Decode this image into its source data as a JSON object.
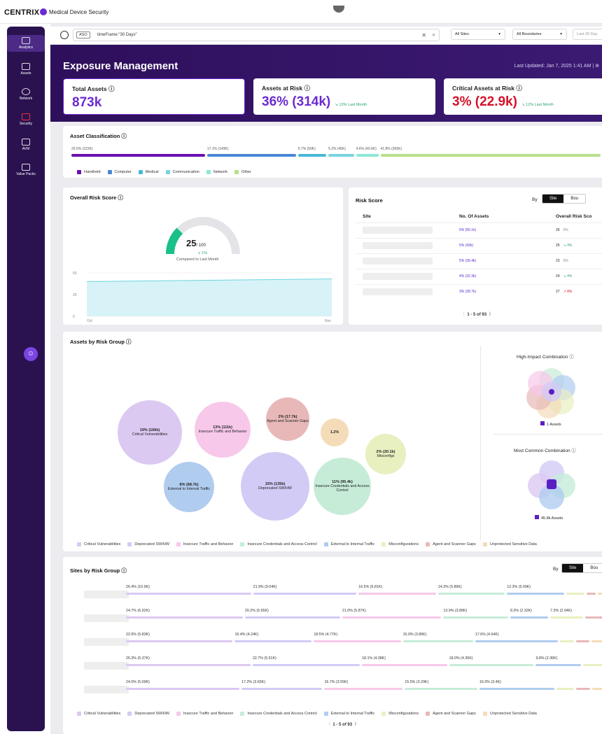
{
  "app": {
    "logo": "CENTRIX",
    "title": "Medical Device Security"
  },
  "sidebar": {
    "items": [
      {
        "label": "Analytics",
        "icon": "analytics-icon"
      },
      {
        "label": "Assets",
        "icon": "assets-icon"
      },
      {
        "label": "Network",
        "icon": "network-icon"
      },
      {
        "label": "Security",
        "icon": "security-icon"
      },
      {
        "label": "AVM",
        "icon": "avm-icon"
      },
      {
        "label": "Value Packs",
        "icon": "value-packs-icon"
      }
    ]
  },
  "filter": {
    "aso": "ASO",
    "query": "timeFrame:\"30 Days\"",
    "clear": "✕",
    "search": "⌕",
    "sites": "All Sites",
    "boundaries": "All Boundaries",
    "timeframe": "Last 30 Day"
  },
  "header": {
    "title": "Exposure Management",
    "updated": "Last Updated: Jan 7, 2025 1:41 AM | ⊕"
  },
  "kpis": [
    {
      "label": "Total Assets ⓘ",
      "value": "873k",
      "delta": ""
    },
    {
      "label": "Assets at Risk ⓘ",
      "value": "36% (314k)",
      "delta": "↘ 13% Last Month"
    },
    {
      "label": "Critical Assets at Risk ⓘ",
      "value": "3% (22.9k)",
      "delta": "↘ 12% Last Month"
    }
  ],
  "classification": {
    "title": "Asset Classification ⓘ",
    "segments": [
      {
        "label": "25.5% (223K)",
        "pct": 25.5,
        "color": "#6a0fb0"
      },
      {
        "label": "17.1% (149K)",
        "pct": 17.1,
        "color": "#4a86d6"
      },
      {
        "label": "5.7% (50K)",
        "pct": 5.7,
        "color": "#49b8d8"
      },
      {
        "label": "5.2% (45K)",
        "pct": 5.2,
        "color": "#7ad3e0"
      },
      {
        "label": "4.6% (40.6K)",
        "pct": 4.6,
        "color": "#8de8d6"
      },
      {
        "label": "41.8% (365K)",
        "pct": 41.8,
        "color": "#b8e08a"
      }
    ],
    "legend": [
      {
        "label": "Handheld",
        "color": "#6a0fb0"
      },
      {
        "label": "Computer",
        "color": "#4a86d6"
      },
      {
        "label": "Medical",
        "color": "#49b8d8"
      },
      {
        "label": "Communication",
        "color": "#7ad3e0"
      },
      {
        "label": "Network",
        "color": "#8de8d6"
      },
      {
        "label": "Other",
        "color": "#b8e08a"
      }
    ]
  },
  "overall_risk": {
    "title": "Overall Risk Score ⓘ",
    "score": "25",
    "of": "/ 100",
    "delta": "↘ 1%",
    "note": "Compared to Last Month",
    "score_value": 25
  },
  "chart_data": {
    "type": "area",
    "x": [
      "Oct",
      "Nov"
    ],
    "values": [
      40,
      43
    ],
    "xlabel": "",
    "ylabel": "",
    "yticks": [
      "50",
      "25",
      "0"
    ],
    "ylim": [
      0,
      50
    ]
  },
  "risk_score": {
    "title": "Risk Score",
    "by": "By",
    "site": "Site",
    "boundary": "Bou",
    "columns": [
      "Site",
      "No. Of Assets",
      "Overall Risk Sco"
    ],
    "rows": [
      {
        "assets": "6% (55.1k)",
        "score": "26",
        "delta": "0%",
        "dcolor": "#888"
      },
      {
        "assets": "5% (43k)",
        "score": "25",
        "delta": "↘ 4%",
        "dcolor": "#2aa36b"
      },
      {
        "assets": "5% (39.4k)",
        "score": "23",
        "delta": "0%",
        "dcolor": "#888"
      },
      {
        "assets": "4% (32.3k)",
        "score": "24",
        "delta": "↘ 4%",
        "dcolor": "#2aa36b"
      },
      {
        "assets": "3% (28.7k)",
        "score": "27",
        "delta": "↗ 8%",
        "dcolor": "#d4122a"
      }
    ],
    "pager": "1 - 5 of 93"
  },
  "risk_group": {
    "title": "Assets by Risk Group ⓘ",
    "bubbles": [
      {
        "pct": "19% (166k)",
        "label": "Critical Vulnerabilities",
        "color": "#dcc9f2"
      },
      {
        "pct": "13% (111k)",
        "label": "Insecure Traffic and Behavior",
        "color": "#f7c8ea"
      },
      {
        "pct": "2% (17.7k)",
        "label": "Agent and Scanner Gaps",
        "color": "#e8b8b8"
      },
      {
        "pct": "1.2%",
        "label": "",
        "color": "#f4dcb8"
      },
      {
        "pct": "2% (20.1k)",
        "label": "Misconfigs",
        "color": "#e8f0c0"
      },
      {
        "pct": "8% (68.7k)",
        "label": "External to Internal Traffic",
        "color": "#b0ccef"
      },
      {
        "pct": "15% (135k)",
        "label": "Deprecated SW/HW",
        "color": "#d2cbf5"
      },
      {
        "pct": "11% (95.4k)",
        "label": "Insecure Credentials and Access Control",
        "color": "#c6ecd8"
      }
    ],
    "high_impact": {
      "title": "High-Impact Combination ⓘ",
      "legend": "1 Assets"
    },
    "most_common": {
      "title": "Most Common Combination ⓘ",
      "legend": "45.8k Assets"
    },
    "legend": [
      {
        "label": "Critical Vulnerabilities",
        "color": "#dcc9f2"
      },
      {
        "label": "Deprecated SW/HW",
        "color": "#d2cbf5"
      },
      {
        "label": "Insecure Traffic and Behavior",
        "color": "#f7c8ea"
      },
      {
        "label": "Insecure Credentials and Access Control",
        "color": "#c6ecd8"
      },
      {
        "label": "External to Internal Traffic",
        "color": "#b0ccef"
      },
      {
        "label": "Misconfigurations",
        "color": "#e8f0c0"
      },
      {
        "label": "Agent and Scanner Gaps",
        "color": "#e8b8b8"
      },
      {
        "label": "Unprotected Sensitive Data",
        "color": "#f4dcb8"
      }
    ]
  },
  "sites_group": {
    "title": "Sites by Risk Group ⓘ",
    "by": "By",
    "site": "Site",
    "boundary": "Bou",
    "rows": [
      {
        "segs": [
          {
            "p": 26.4,
            "l": "26.4% (10.9K)"
          },
          {
            "p": 21.9,
            "l": "21.9% (9.04K)"
          },
          {
            "p": 16.5,
            "l": "16.5% (6.81K)"
          },
          {
            "p": 14.3,
            "l": "14.3% (5.89K)"
          },
          {
            "p": 12.3,
            "l": "12.3% (5.09K)"
          },
          {
            "p": 4.3,
            "l": ""
          },
          {
            "p": 2.3,
            "l": ""
          },
          {
            "p": 2.0,
            "l": ""
          }
        ]
      },
      {
        "segs": [
          {
            "p": 24.7,
            "l": "24.7% (6.92K)"
          },
          {
            "p": 20.2,
            "l": "20.2% (5.65K)"
          },
          {
            "p": 21.0,
            "l": "21.0% (5.87K)"
          },
          {
            "p": 13.9,
            "l": "13.9% (3.89K)"
          },
          {
            "p": 8.3,
            "l": "8.3% (2.32K)"
          },
          {
            "p": 7.3,
            "l": "7.3% (2.04K)"
          },
          {
            "p": 4.6,
            "l": ""
          }
        ]
      },
      {
        "segs": [
          {
            "p": 22.6,
            "l": "22.6% (5.83K)"
          },
          {
            "p": 16.4,
            "l": "16.4% (4.24K)"
          },
          {
            "p": 18.5,
            "l": "18.5% (4.77K)"
          },
          {
            "p": 15.0,
            "l": "15.0% (3.86K)"
          },
          {
            "p": 17.6,
            "l": "17.6% (4.54K)"
          },
          {
            "p": 3.4,
            "l": ""
          },
          {
            "p": 3.2,
            "l": ""
          },
          {
            "p": 3.3,
            "l": ""
          }
        ]
      },
      {
        "segs": [
          {
            "p": 26.3,
            "l": "26.3% (6.37K)"
          },
          {
            "p": 22.7,
            "l": "22.7% (5.51K)"
          },
          {
            "p": 18.1,
            "l": "18.1% (4.38K)"
          },
          {
            "p": 18.0,
            "l": "18.0% (4.35K)"
          },
          {
            "p": 9.8,
            "l": "9.8% (2.36K)"
          },
          {
            "p": 5.1,
            "l": ""
          }
        ]
      },
      {
        "segs": [
          {
            "p": 24.0,
            "l": "24.0% (5.09K)"
          },
          {
            "p": 17.2,
            "l": "17.2% (3.65K)"
          },
          {
            "p": 16.7,
            "l": "16.7% (3.55K)"
          },
          {
            "p": 15.5,
            "l": "15.5% (3.29K)"
          },
          {
            "p": 16.0,
            "l": "16.0% (3.4K)"
          },
          {
            "p": 4.0,
            "l": ""
          },
          {
            "p": 3.4,
            "l": ""
          },
          {
            "p": 3.2,
            "l": ""
          }
        ]
      }
    ],
    "colors": [
      "#dcc9f2",
      "#d2cbf5",
      "#f7c8ea",
      "#c6ecd8",
      "#b0ccef",
      "#e8f0c0",
      "#e8b8b8",
      "#f4dcb8"
    ],
    "pager": "1 - 5 of 93"
  }
}
